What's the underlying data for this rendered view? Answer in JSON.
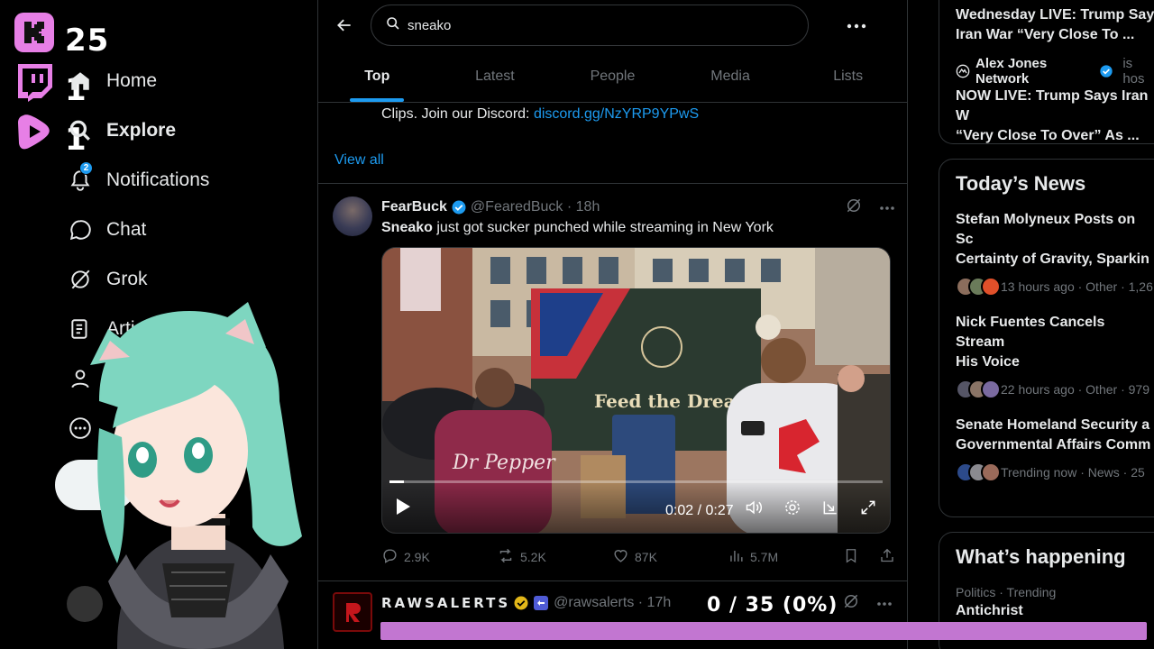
{
  "overlay": {
    "kick_count": "25",
    "twitch_count": "1",
    "rumble_count": "1",
    "goal_text": "0 / 35 (0%)",
    "goal_progress": 0,
    "colors": {
      "kick": "#e77fe6",
      "goal_bar": "#c276d1"
    }
  },
  "nav": {
    "items": [
      {
        "label": "Home",
        "icon": "home-icon"
      },
      {
        "label": "Explore",
        "icon": "search-icon"
      },
      {
        "label": "Notifications",
        "icon": "bell-icon",
        "badge": "2"
      },
      {
        "label": "Chat",
        "icon": "chat-icon"
      },
      {
        "label": "Grok",
        "icon": "grok-icon"
      },
      {
        "label": "Articles",
        "icon": "articles-icon"
      }
    ]
  },
  "search": {
    "value": "sneako"
  },
  "tabs": [
    "Top",
    "Latest",
    "People",
    "Media",
    "Lists"
  ],
  "prev_tweet": {
    "snippet": "Clips. Join our Discord:",
    "link": "discord.gg/NzYRP9YPwS",
    "view_all": "View all"
  },
  "tweet": {
    "name": "FearBuck",
    "handle": "@FearedBuck",
    "time": "18h",
    "text_bold": "Sneako",
    "text_rest": " just got sucker punched while streaming in New York",
    "video_time": "0:02 / 0:27",
    "video_progress": 0.03,
    "banner_text": "Feed the Dream.",
    "shirt_text": "Dr Pepper",
    "replies": "2.9K",
    "reposts": "5.2K",
    "likes": "87K",
    "views": "5.7M"
  },
  "tweet2": {
    "name": "RAWSALERTS",
    "handle": "@rawsalerts",
    "time": "17h"
  },
  "right": {
    "top_news": [
      {
        "headline_1": "Wednesday LIVE: Trump Say",
        "headline_2": "Iran War “Very Close To ..."
      },
      {
        "source": "Alex Jones Network",
        "source_suffix": "is hos",
        "headline_1": "NOW LIVE: Trump Says Iran W",
        "headline_2": "“Very Close To Over” As ..."
      }
    ],
    "todays_news_title": "Today’s News",
    "todays_news": [
      {
        "headline_1": "Stefan Molyneux Posts on Sc",
        "headline_2": "Certainty of Gravity, Sparkin",
        "meta": "13 hours ago · Other · 1,26"
      },
      {
        "headline_1": "Nick Fuentes Cancels Stream",
        "headline_2": "His Voice",
        "meta": "22 hours ago · Other · 979"
      },
      {
        "headline_1": "Senate Homeland Security a",
        "headline_2": "Governmental Affairs Comm",
        "meta": "Trending now · News · 25"
      }
    ],
    "whats_happening_title": "What’s happening",
    "trend": {
      "meta": "Politics · Trending",
      "name": "Antichrist"
    }
  }
}
